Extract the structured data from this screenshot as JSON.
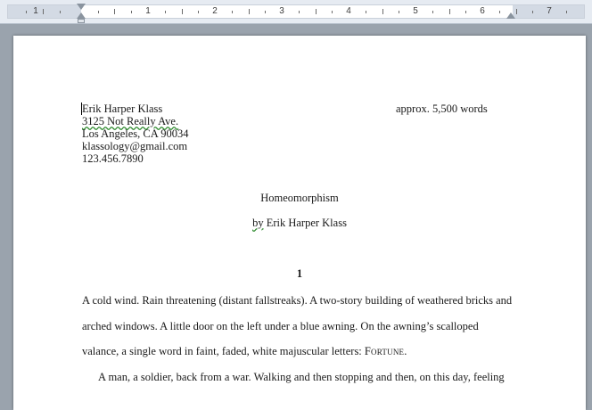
{
  "ruler": {
    "numbers": [
      "1",
      "1",
      "2",
      "3",
      "4",
      "5",
      "6",
      "7"
    ]
  },
  "document": {
    "header": {
      "name": "Erik Harper Klass",
      "street": "3125 Not Really Ave.",
      "city": "Los Angeles, CA 90034",
      "email": "klassology@gmail.com",
      "phone": "123.456.7890",
      "word_count": "approx. 5,500 words"
    },
    "title": "Homeomorphism",
    "byline_by": "by",
    "byline_author": "Erik Harper Klass",
    "section_number": "1",
    "paragraph1": {
      "line1": "A cold wind. Rain threatening (distant fallstreaks). A two-story building of weathered bricks and",
      "line2": "arched windows. A little door on the left under a blue awning. On the awning’s scalloped",
      "line3": "valance, a single word in faint, faded, white majuscular letters: ",
      "line3_smallcaps": "Fortune",
      "line3_end": "."
    },
    "paragraph2": {
      "line1": "A man, a soldier, back from a war. Walking and then stopping and then, on this day, feeling"
    }
  },
  "colors": {
    "workspace": "#9aa3ad",
    "page": "#ffffff",
    "ruler": "#e6ebf2",
    "spellcheck_squiggle": "#2d8a2d"
  }
}
